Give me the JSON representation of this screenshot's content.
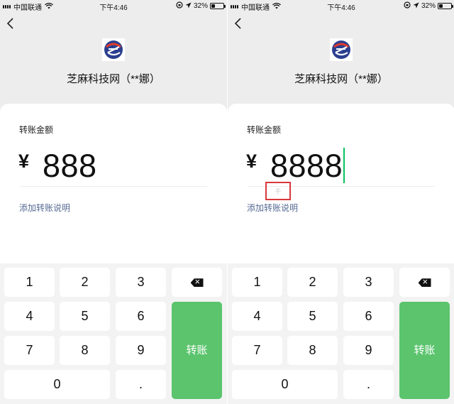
{
  "status_bar": {
    "carrier": "中国联通",
    "time": "下午4:46",
    "battery": "32%",
    "battery_level": 0.32
  },
  "payee": {
    "name": "芝麻科技网（**娜）"
  },
  "form": {
    "label": "转账金额",
    "currency_symbol": "¥",
    "add_note_link": "添加转账说明"
  },
  "screens": [
    {
      "amount": "888"
    },
    {
      "amount": "8888",
      "unit_hint": "千"
    }
  ],
  "keypad": {
    "keys": [
      "1",
      "2",
      "3",
      "4",
      "5",
      "6",
      "7",
      "8",
      "9",
      "0",
      "."
    ],
    "delete_icon": "backspace-icon",
    "transfer_label": "转账"
  },
  "colors": {
    "transfer_button": "#5bc46d",
    "link": "#576b95",
    "cursor": "#07c160",
    "annotation_box": "#d9383b"
  }
}
